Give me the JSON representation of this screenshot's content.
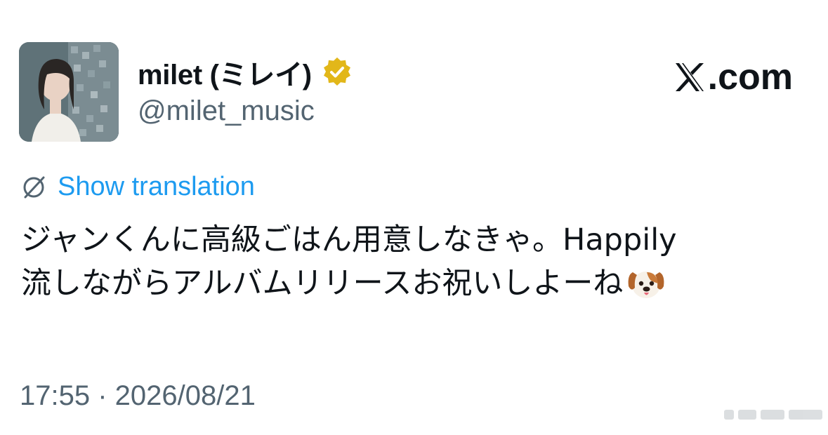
{
  "author": {
    "display_name": "milet (ミレイ)",
    "handle": "@milet_music",
    "verified_icon": "verified-badge-gold",
    "avatar": "profile-photo"
  },
  "brand": {
    "site": ".com",
    "logo_icon": "x-logo"
  },
  "translation": {
    "icon": "globe-translate-icon",
    "label": "Show translation"
  },
  "tweet": {
    "lines": [
      "ジャンくんに高級ごはん用意しなきゃ。Happily",
      "流しながらアルバムリリースお祝いしよーね"
    ],
    "emoji": "dog-face"
  },
  "timestamp": "17:55 · 2026/08/21",
  "colors": {
    "link": "#1d9bf0",
    "secondary_text": "#536471",
    "verified": "#e2b719"
  }
}
